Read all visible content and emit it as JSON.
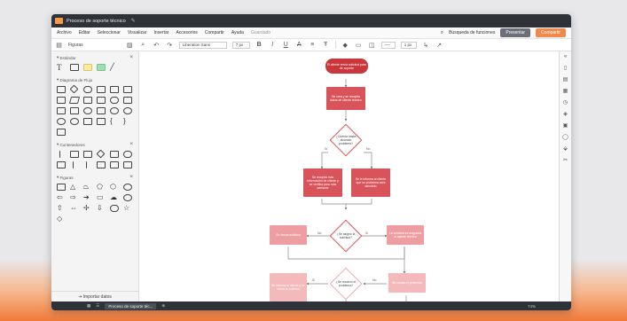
{
  "window": {
    "title": "Proceso de soporte técnico"
  },
  "menu": {
    "items": [
      "Archivo",
      "Editar",
      "Seleccionar",
      "Visualizar",
      "Insertar",
      "Accesorios",
      "Compartir",
      "Ayuda"
    ],
    "saved": "Guardado",
    "feature_search": "Búsqueda de funciones",
    "present": "Presentar",
    "share": "Compartir"
  },
  "toolbar": {
    "shapes_label": "Figuras",
    "font": "Liberation Sans",
    "font_size": "7 px",
    "line_width": "1 px"
  },
  "sidebar": {
    "sections": [
      {
        "label": "Estándar"
      },
      {
        "label": "Diagrama de Flujo"
      },
      {
        "label": "Contenedores"
      },
      {
        "label": "Figuras"
      }
    ],
    "import": "Importar datos"
  },
  "status": {
    "page": "Proceso de soporte téc...",
    "zoom": "74%"
  },
  "diagram": {
    "start": "El cliente envía solicitud para de soporte",
    "step1": "Se crea y se recopila datos de cliente técnico",
    "d1": "¿Cuenta hasta alcanzar problema?",
    "left_box": "Se recopila más información de cliente y se verifica para más adelante",
    "right_box": "Se le informa al cliente que su problema será atendido",
    "d2": "¿Se asignó la solicitud?",
    "left2": "Se deriva solicitud",
    "right2": "La solicitud es asignada al agente técnico",
    "d3": "¿Se resolvió el problema?",
    "left3": "Se informa al cliente y se cierra la solicitud",
    "right3": "Se escala el problema",
    "yes": "Sí",
    "no": "No"
  },
  "colors": {
    "accent": "#f08a4b",
    "node": "#d9545a",
    "start": "#c9373d"
  }
}
